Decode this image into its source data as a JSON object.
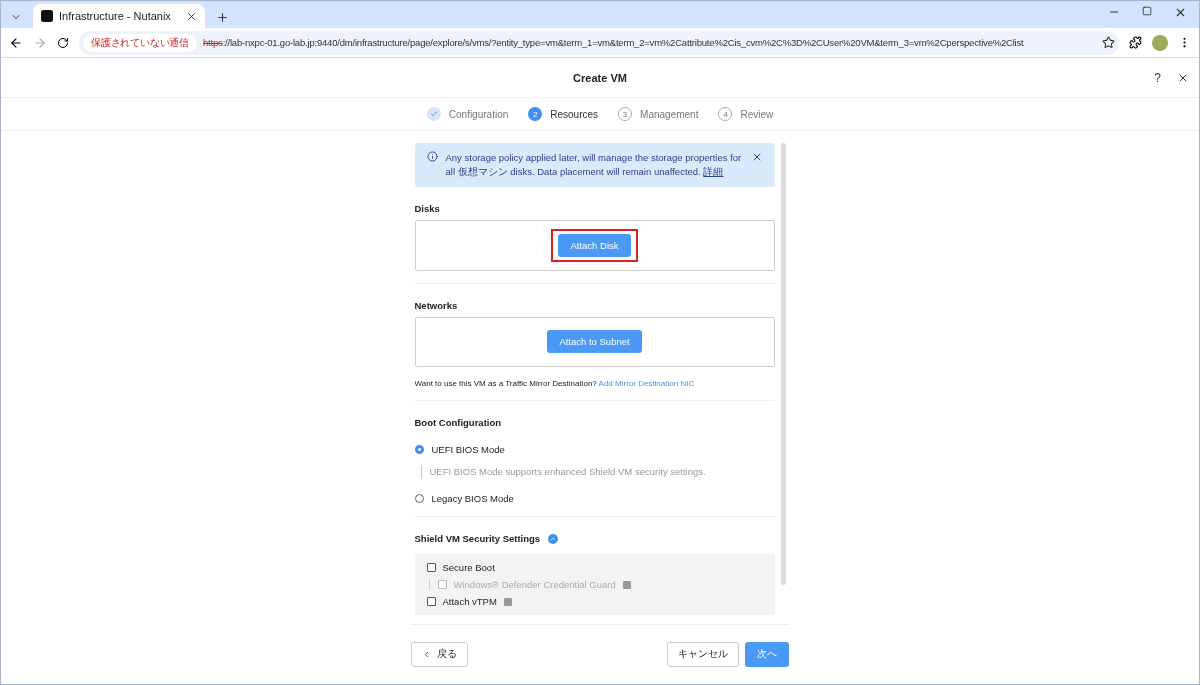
{
  "browser": {
    "tab_title": "Infrastructure - Nutanix",
    "security_label": "保護されていない通信",
    "url_scheme": "https",
    "url_rest": "://lab-nxpc-01.go-lab.jp:9440/dm/infrastructure/page/explore/s/vms/?entity_type=vm&term_1=vm&term_2=vm%2Cattribute%2Cis_cvm%2C%3D%2CUser%20VM&term_3=vm%2Cperspective%2Clist"
  },
  "dialog": {
    "title": "Create VM",
    "help": "?"
  },
  "steps": [
    {
      "label": "Configuration",
      "kind": "done"
    },
    {
      "number": "2",
      "label": "Resources",
      "kind": "current"
    },
    {
      "number": "3",
      "label": "Management",
      "kind": "pending"
    },
    {
      "number": "4",
      "label": "Review",
      "kind": "pending"
    }
  ],
  "notice": {
    "text": "Any storage policy applied later, will manage the storage properties for all 仮想マシン disks. Data placement will remain unaffected.",
    "link": "詳細"
  },
  "disks": {
    "heading": "Disks",
    "button": "Attach Disk",
    "highlighted": true
  },
  "networks": {
    "heading": "Networks",
    "button": "Attach to Subnet",
    "highlighted": false
  },
  "mirror": {
    "question": "Want to use this VM as a Traffic Mirror Destination?",
    "link": "Add Mirror Destination NIC"
  },
  "boot": {
    "heading": "Boot Configuration",
    "options": [
      {
        "label": "UEFI BIOS Mode",
        "selected": true,
        "hint": "UEFI BIOS Mode supports enhanced Shield VM security settings."
      },
      {
        "label": "Legacy BIOS Mode",
        "selected": false
      }
    ]
  },
  "shield": {
    "heading": "Shield VM Security Settings",
    "expanded": true,
    "options": [
      {
        "label": "Secure Boot",
        "checked": false,
        "disabled": false,
        "nested": false,
        "help": false
      },
      {
        "label": "Windows® Defender Credential Guard",
        "checked": false,
        "disabled": true,
        "nested": true,
        "help": true
      },
      {
        "label": "Attach vTPM",
        "checked": false,
        "disabled": false,
        "nested": false,
        "help": true
      }
    ]
  },
  "footer": {
    "back": "戻る",
    "cancel": "キャンセル",
    "next": "次へ"
  }
}
